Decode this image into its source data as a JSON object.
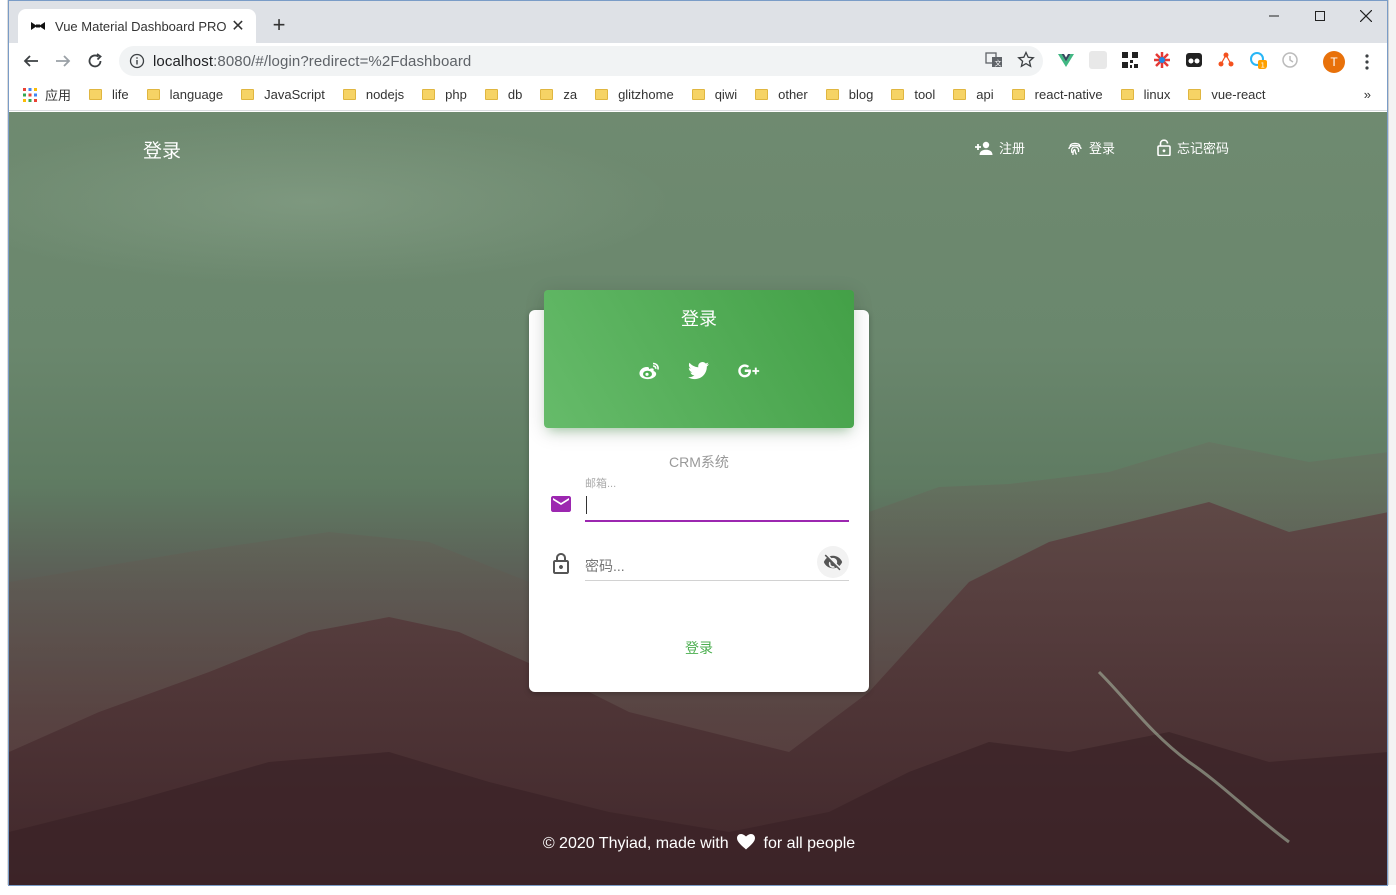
{
  "browser": {
    "tab_title": "Vue Material Dashboard PRO",
    "new_tab": "+",
    "url_host": "localhost",
    "url_rest": ":8080/#/login?redirect=%2Fdashboard",
    "avatar_letter": "T"
  },
  "bookmarks": {
    "apps_label": "应用",
    "items": [
      "life",
      "language",
      "JavaScript",
      "nodejs",
      "php",
      "db",
      "za",
      "glitzhome",
      "qiwi",
      "other",
      "blog",
      "tool",
      "api",
      "react-native",
      "linux",
      "vue-react"
    ],
    "more": "»"
  },
  "navbar": {
    "brand": "登录",
    "links": [
      {
        "label": "注册",
        "icon": "person-add-icon"
      },
      {
        "label": "登录",
        "icon": "fingerprint-icon"
      },
      {
        "label": "忘记密码",
        "icon": "lock-open-icon"
      }
    ]
  },
  "login_card": {
    "title": "登录",
    "socials": [
      "weibo-icon",
      "twitter-icon",
      "google-plus-icon"
    ],
    "subtitle": "CRM系统",
    "email_label": "邮箱...",
    "email_value": "",
    "password_placeholder": "密码...",
    "submit_label": "登录"
  },
  "footer": {
    "prefix": "© 2020 Thyiad, made with",
    "suffix": "for all people"
  },
  "colors": {
    "header_green": "#4caf50",
    "accent_purple": "#9c27b0",
    "avatar_orange": "#e8710a"
  }
}
